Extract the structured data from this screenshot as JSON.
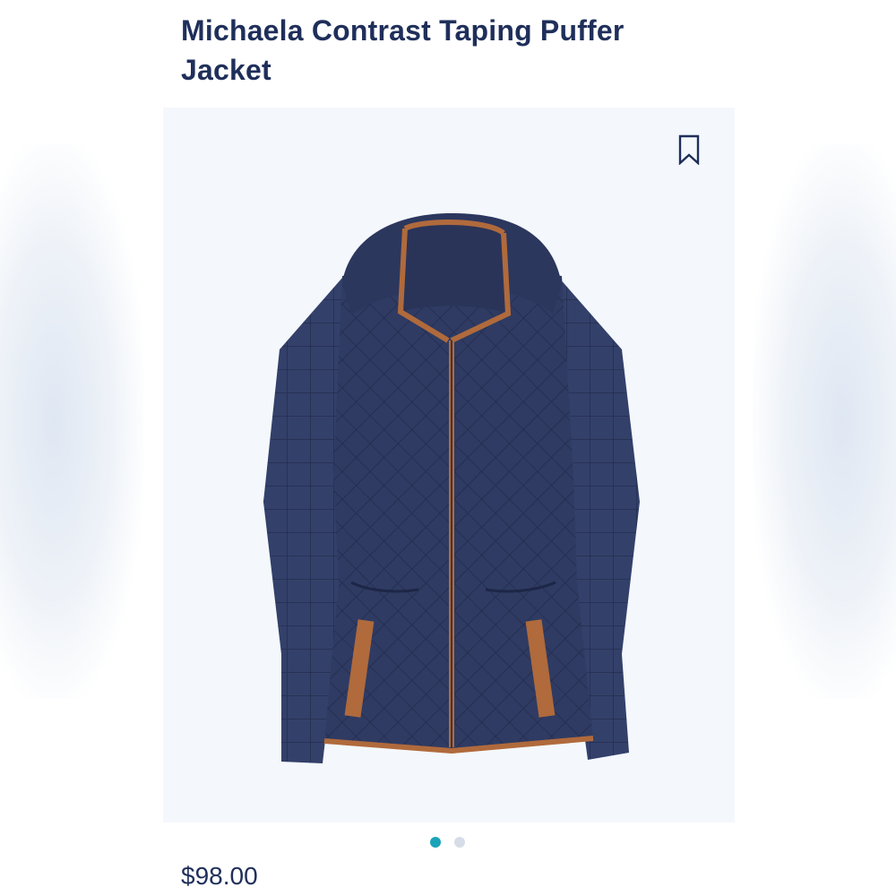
{
  "product": {
    "title": "Michaela Contrast Taping Puffer Jacket",
    "price": "$98.00"
  },
  "icons": {
    "bookmark": "bookmark-icon"
  },
  "carousel": {
    "total": 2,
    "active_index": 0
  },
  "colors": {
    "title_text": "#1f2f5a",
    "active_dot": "#1aa3b8",
    "inactive_dot": "#d6dde8",
    "jacket_navy": "#2e3a62",
    "trim_tan": "#b06a3c"
  }
}
